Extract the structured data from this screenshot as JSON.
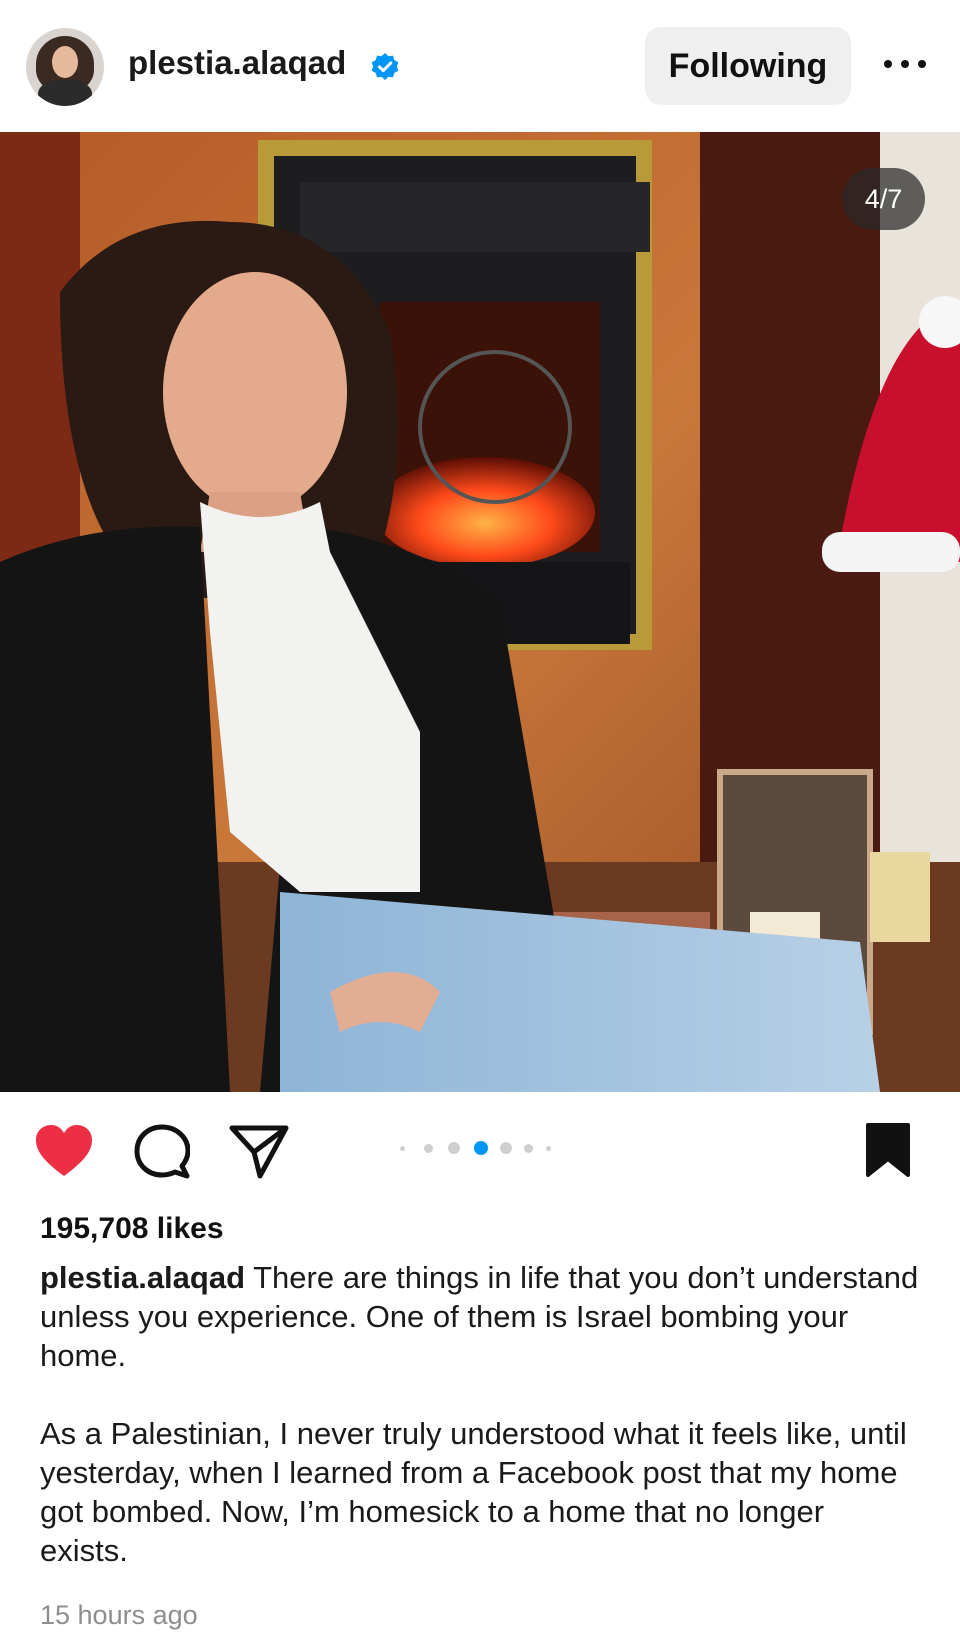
{
  "header": {
    "username": "plestia.alaqad",
    "follow_label": "Following",
    "verified_icon": "verified-badge-icon",
    "more_icon": "more-options-icon"
  },
  "post": {
    "image_counter": "4/7",
    "carousel": {
      "total": 7,
      "active_index": 3
    },
    "liked": true,
    "saved": true,
    "likes": "195,708 likes",
    "caption_user": "plestia.alaqad",
    "caption_para1": "There are things in life that you don’t understand unless you experience. One of them is Israel bombing your home.",
    "caption_para2": "As a Palestinian, I never truly understood what it feels like, until yesterday, when I learned from a Facebook post that my home got bombed. Now, I’m homesick to a home that no longer exists.",
    "timestamp": "15 hours ago"
  },
  "colors": {
    "like_red": "#ed2f45",
    "carousel_active": "#0095f6",
    "verified_blue": "#0095f6"
  }
}
